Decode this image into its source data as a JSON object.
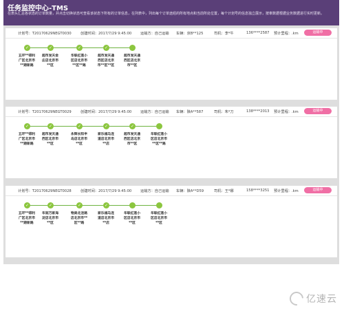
{
  "header": {
    "title": "任务监控中心-TMS",
    "description": "在表头汇总各状态的订单数量，并点击切换状态可查看该状态下所有的订单信息，在列表中，列出每个订单途经的所有地点和当前所处位置，每个计划号的信息独立展示，按車数据根据业务数据进行实时更新。"
  },
  "plans": [
    {
      "plan_no": "计划号：T20170629NEGT0030",
      "created": "创建时间：2017/7/29 9:45:00",
      "transport": "运输方：自己运输",
      "vehicle": "车辆：京B**125",
      "driver": "司机：李*牛",
      "phone": "136****2587",
      "mileage": "预计里程：.km",
      "button": "运输中",
      "stops": [
        "五环**得利广区北京市**期新路",
        "超市发天金庄店北京市**区",
        "华联红莲小区店北京市**区**路",
        "超市发天通西区店北京市**区**区",
        "超市发天通西区店北京市**区"
      ]
    },
    {
      "plan_no": "计划号：T20170629NEGT0029",
      "created": "创建时间：2017/7/29 9:45:00",
      "transport": "运输方：自己运输",
      "vehicle": "车辆：陕A**587",
      "driver": "司机：朱*刀",
      "phone": "138****2013",
      "mileage": "预计里程：.km",
      "button": "运输中",
      "stops": [
        "五环**得利广区北京市**期新路",
        "超市发天通西区北京市**区",
        "永辉长阳半岛店北京市**区",
        "家乐福马连道店北京市**店",
        "超市发天通西区店北京市**区",
        "华联红莲小区店北京市**区**路"
      ]
    },
    {
      "plan_no": "计划号：T20170629NEGT0028",
      "created": "创建时间：2017/7/29 9:45:00",
      "transport": "运输方：自己运输",
      "vehicle": "车辆：陕A**D59",
      "driver": "司机：王*娜",
      "phone": "158****3251",
      "mileage": "预计里程：.km",
      "button": "运输中",
      "stops": [
        "五环**得利广区北京市**期新路",
        "华润万家海淀店北京市**区",
        "物美北洼路店北京市**区**路",
        "家乐福马连道店北京市**店",
        "华联红莲小区店北京市**区",
        "华联红莲小区店北京市**区"
      ]
    }
  ],
  "watermark": "亿速云",
  "colors": {
    "header": "#5a3f78",
    "node": "#8cc63f",
    "button": "#f06fa5"
  }
}
